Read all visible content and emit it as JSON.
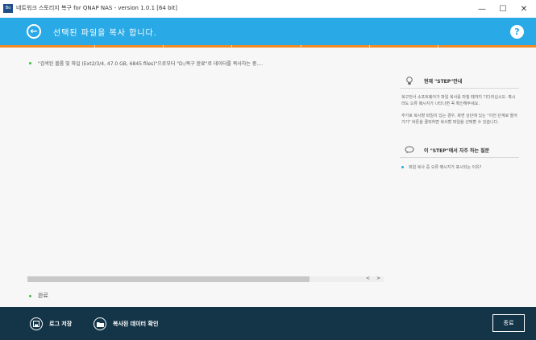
{
  "window": {
    "icon_text": "Bo",
    "title": "네트워크 스토리지 복구 for QNAP NAS - version 1.0.1 [64 bit]",
    "minimize_glyph": "—",
    "maximize_glyph": "☐",
    "close_glyph": "✕"
  },
  "header": {
    "back_glyph": "←",
    "title": "선택된 파일을 복사 합니다.",
    "help_glyph": "?",
    "bg_color": "#29a9e6",
    "progress_color": "#f08a24"
  },
  "main": {
    "log_line": "\"검색된 볼륨 및 파일 (Ext2/3/4, 47.0 GB, 6845 files)\"으로부터 \"D:/복구 완료\"로 데이터를 복사하는 중....",
    "scroll_left": "<",
    "scroll_right": ">",
    "status": "완료"
  },
  "side": {
    "step_icon": "lightbulb-icon",
    "step_title": "현재 \"STEP\"안내",
    "step_para1": "복구전사 소프트웨어가 파일 복사를 마칠 때까지 기다리십시오. 혹시라도 오류 메시지가 나타나면 꼭 확인해주세요.",
    "step_para2": "추가로 복사할 파일이 있는 경우, 화면 상단에 있는 \"이전 단계로 돌아가기\" 버튼을 클릭하면 복사할 파일을 선택할 수 있습니다.",
    "faq_icon": "speech-bubble-icon",
    "faq_title": "이 \"STEP\"에서 자주 하는 질문",
    "faq_item1": "파일 복사 중 오류 메시지가 표시되는 이유?"
  },
  "footer": {
    "save_log_label": "로그 저장",
    "check_data_label": "복사된 데이터 확인",
    "close_label": "종료",
    "bg_color": "#143548"
  }
}
